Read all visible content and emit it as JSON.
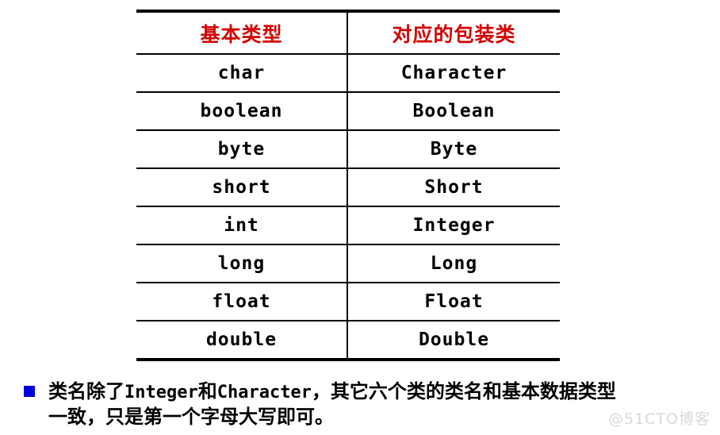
{
  "slide": {
    "background_color": "#ffffff",
    "accent_color": "#d40000",
    "bullet_color": "#0000d8",
    "rule_color": "#000000"
  },
  "table": {
    "headers": {
      "primitive": "基本类型",
      "wrapper": "对应的包装类"
    },
    "rows": [
      {
        "primitive": "char",
        "wrapper": "Character"
      },
      {
        "primitive": "boolean",
        "wrapper": "Boolean"
      },
      {
        "primitive": "byte",
        "wrapper": "Byte"
      },
      {
        "primitive": "short",
        "wrapper": "Short"
      },
      {
        "primitive": "int",
        "wrapper": "Integer"
      },
      {
        "primitive": "long",
        "wrapper": "Long"
      },
      {
        "primitive": "float",
        "wrapper": "Float"
      },
      {
        "primitive": "double",
        "wrapper": "Double"
      }
    ]
  },
  "note": {
    "bullet_glyph": "square-bullet",
    "line1_part1": "类名除了",
    "line1_mono1": "Integer",
    "line1_part2": "和",
    "line1_mono2": "Character",
    "line1_part3": "，其它六个类的类名和基本数据类型",
    "line2": "一致，只是第一个字母大写即可。"
  },
  "watermark": {
    "text": "@51CTO博客"
  }
}
